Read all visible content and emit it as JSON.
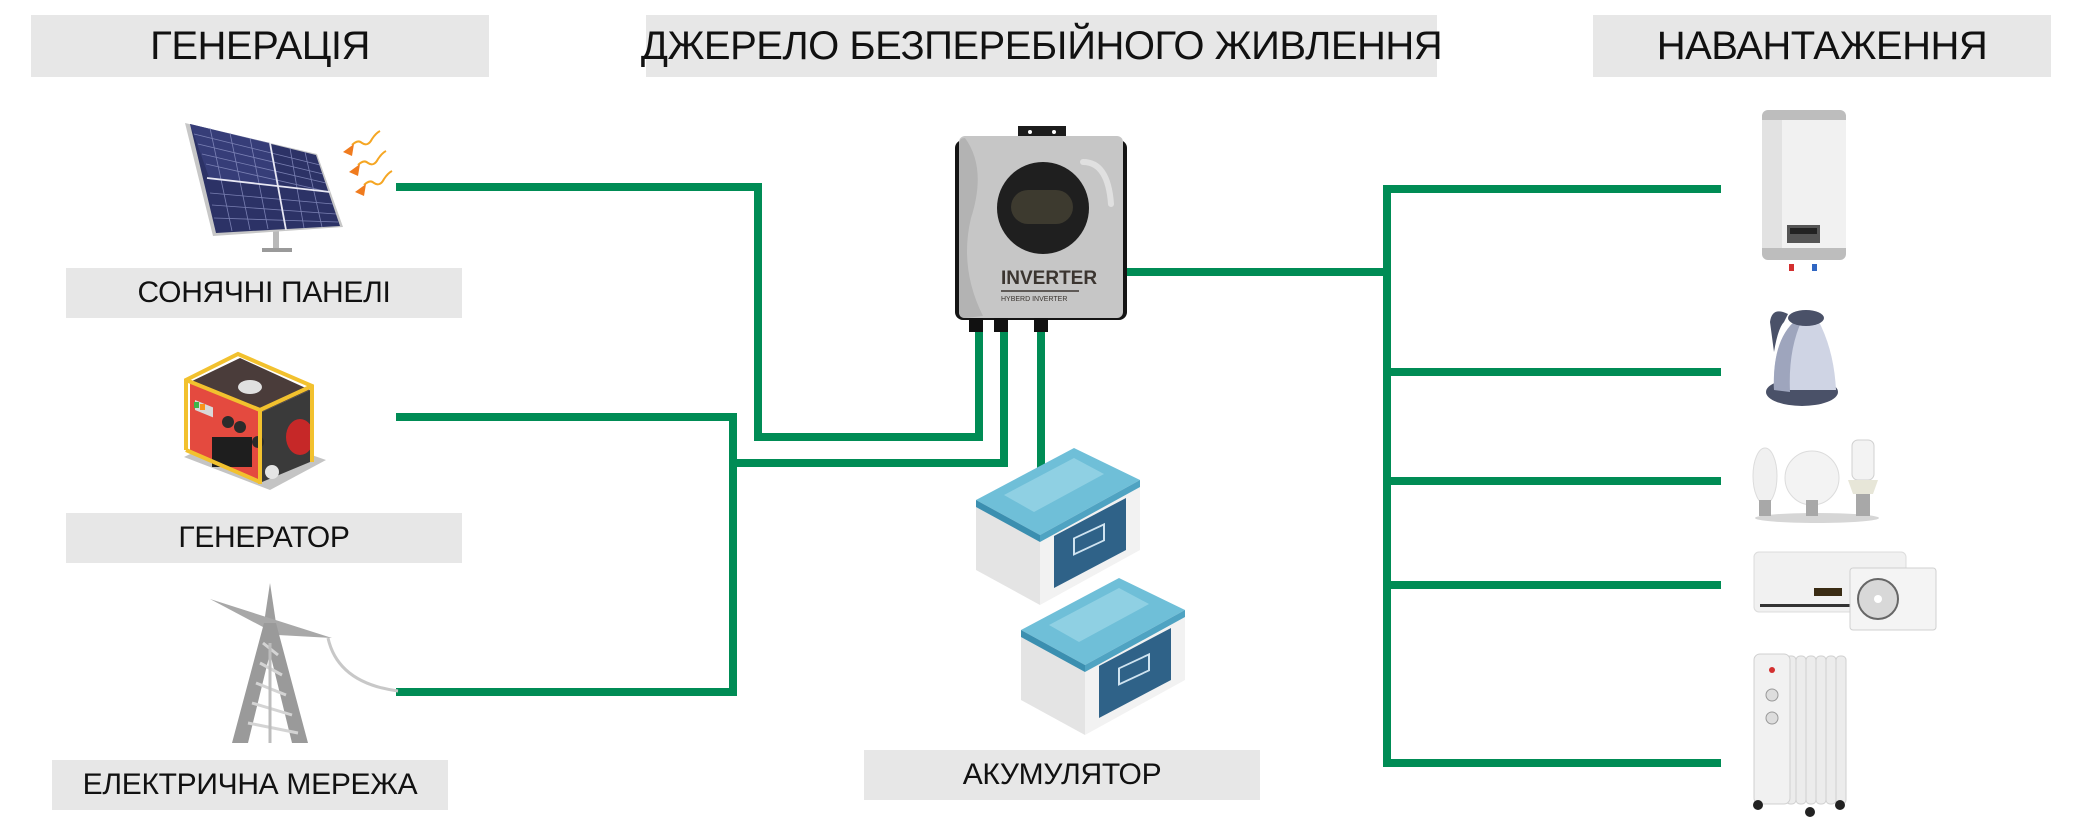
{
  "headers": {
    "generation": "ГЕНЕРАЦІЯ",
    "ups": "ДЖЕРЕЛО БЕЗПЕРЕБІЙНОГО ЖИВЛЕННЯ",
    "load": "НАВАНТАЖЕННЯ"
  },
  "sources": [
    {
      "id": "solar",
      "label": "СОНЯЧНІ ПАНЕЛІ",
      "icon": "solar-panel-icon"
    },
    {
      "id": "generator",
      "label": "ГЕНЕРАТОР",
      "icon": "generator-icon"
    },
    {
      "id": "grid",
      "label": "ЕЛЕКТРИЧНА МЕРЕЖА",
      "icon": "power-tower-icon"
    }
  ],
  "inverter": {
    "brand": "INVERTER",
    "subtitle": "HYBERD INVERTER",
    "icon": "inverter-icon"
  },
  "battery": {
    "label": "АКУМУЛЯТОР",
    "icon": "battery-icon",
    "count": 2
  },
  "loads": [
    {
      "id": "water-heater",
      "icon": "water-heater-icon"
    },
    {
      "id": "kettle",
      "icon": "kettle-icon"
    },
    {
      "id": "light-bulbs",
      "icon": "light-bulbs-icon"
    },
    {
      "id": "air-conditioner",
      "icon": "air-conditioner-icon"
    },
    {
      "id": "oil-heater",
      "icon": "oil-heater-icon"
    }
  ],
  "colors": {
    "wire": "#008c55",
    "label_bg": "#e7e7e7",
    "text": "#111111"
  }
}
